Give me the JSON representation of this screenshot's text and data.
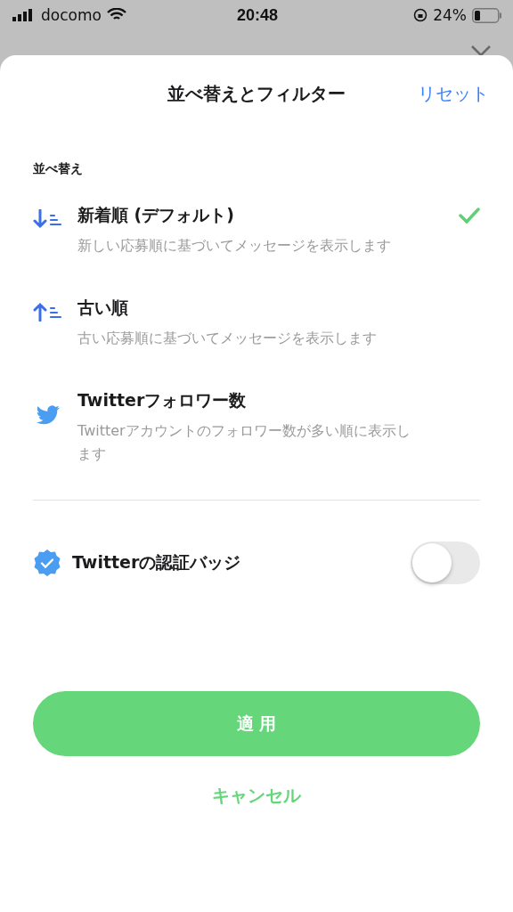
{
  "status_bar": {
    "carrier": "docomo",
    "time": "20:48",
    "battery": "24%"
  },
  "sheet": {
    "title": "並べ替えとフィルター",
    "reset": "リセット"
  },
  "sort": {
    "heading": "並べ替え",
    "options": [
      {
        "kind": "newest",
        "title": "新着順 (デフォルト)",
        "description": "新しい応募順に基づいてメッセージを表示します",
        "selected": true
      },
      {
        "kind": "oldest",
        "title": "古い順",
        "description": "古い応募順に基づいてメッセージを表示します",
        "selected": false
      },
      {
        "kind": "followers",
        "title": "Twitterフォロワー数",
        "description": "Twitterアカウントのフォロワー数が多い順に表示します",
        "selected": false
      }
    ]
  },
  "filter": {
    "label": "Twitterの認証バッジ",
    "on": false
  },
  "buttons": {
    "apply": "適 用",
    "cancel": "キャンセル"
  }
}
